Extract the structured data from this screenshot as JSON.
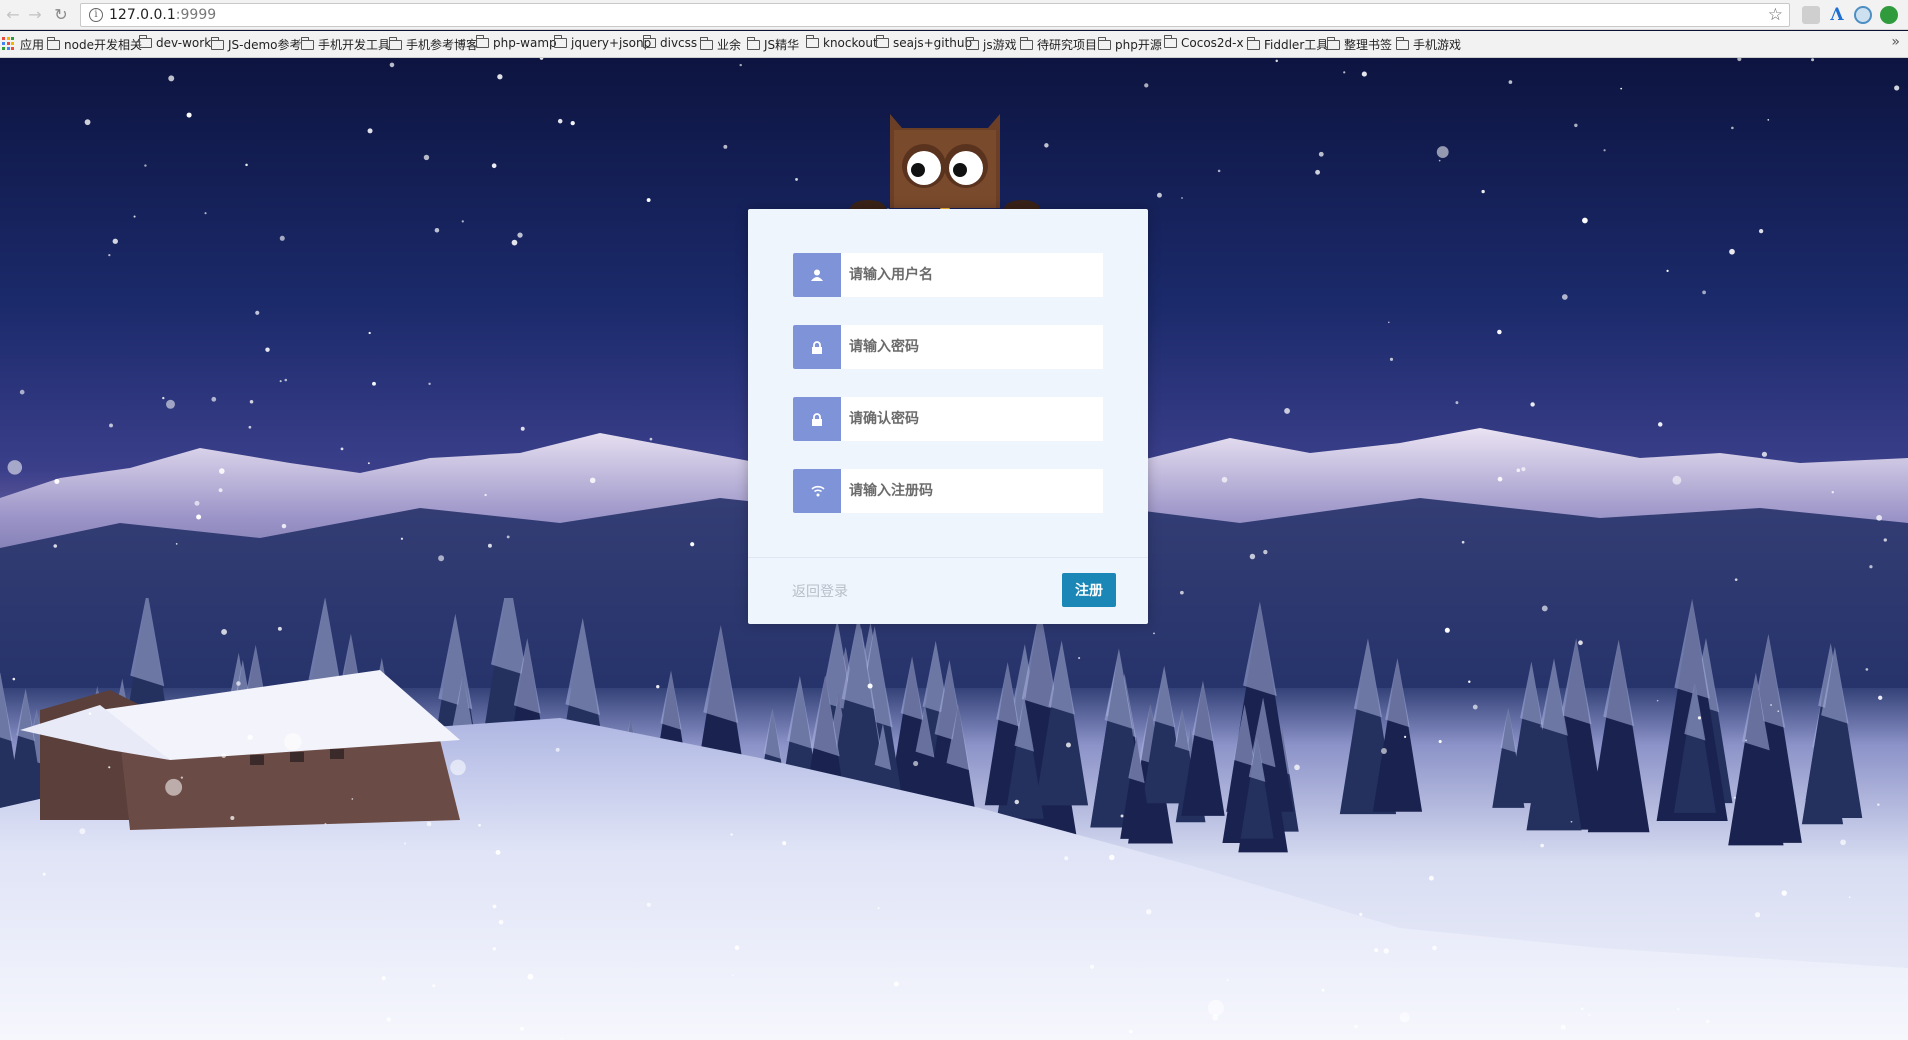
{
  "browser": {
    "url_host": "127.0.0.1",
    "url_port": ":9999",
    "apps_label": "应用",
    "bookmarks": [
      "node开发相关",
      "dev-work",
      "JS-demo参考",
      "手机开发工具",
      "手机参考博客",
      "php-wamp",
      "jquery+jsonp",
      "divcss",
      "业余",
      "JS精华",
      "knockout",
      "seajs+github",
      "js游戏",
      "待研究项目",
      "php开源",
      "Cocos2d-x",
      "Fiddler工具",
      "整理书签",
      "手机游戏"
    ],
    "more_glyph": "»"
  },
  "form": {
    "username_placeholder": "请输入用户名",
    "password_placeholder": "请输入密码",
    "confirm_placeholder": "请确认密码",
    "regcode_placeholder": "请输入注册码",
    "back_link": "返回登录",
    "submit_label": "注册"
  },
  "icons": {
    "username": "user-icon",
    "password": "lock-icon",
    "confirm": "lock-icon",
    "regcode": "wifi-icon"
  },
  "colors": {
    "icon_bg": "#7f94d8",
    "submit_bg": "#1b87b7",
    "panel_bg": "#eef5fd"
  }
}
